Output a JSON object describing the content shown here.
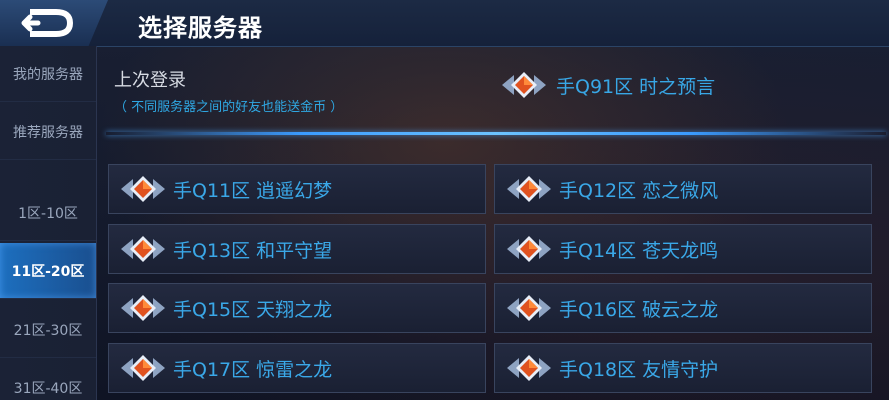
{
  "header": {
    "title": "选择服务器"
  },
  "sidebar": {
    "items": [
      {
        "label": "我的服务器"
      },
      {
        "label": "推荐服务器"
      },
      {
        "label": "1区-10区"
      },
      {
        "label": "11区-20区"
      },
      {
        "label": "21区-30区"
      },
      {
        "label": "31区-40区"
      }
    ],
    "active_index": 3
  },
  "last_login": {
    "label": "上次登录",
    "note": "（ 不同服务器之间的好友也能送金币 ）",
    "server": "手Q91区  时之预言"
  },
  "servers": [
    {
      "name": "手Q11区  逍遥幻梦"
    },
    {
      "name": "手Q12区  恋之微风"
    },
    {
      "name": "手Q13区  和平守望"
    },
    {
      "name": "手Q14区  苍天龙鸣"
    },
    {
      "name": "手Q15区  天翔之龙"
    },
    {
      "name": "手Q16区  破云之龙"
    },
    {
      "name": "手Q17区  惊雷之龙"
    },
    {
      "name": "手Q18区  友情守护"
    }
  ],
  "icons": {
    "back": "back-arrow-icon",
    "server": "gem-icon"
  },
  "colors": {
    "accent": "#3aa8e8",
    "active_tab": "#1d6fbf",
    "note": "#2fa7e2"
  }
}
